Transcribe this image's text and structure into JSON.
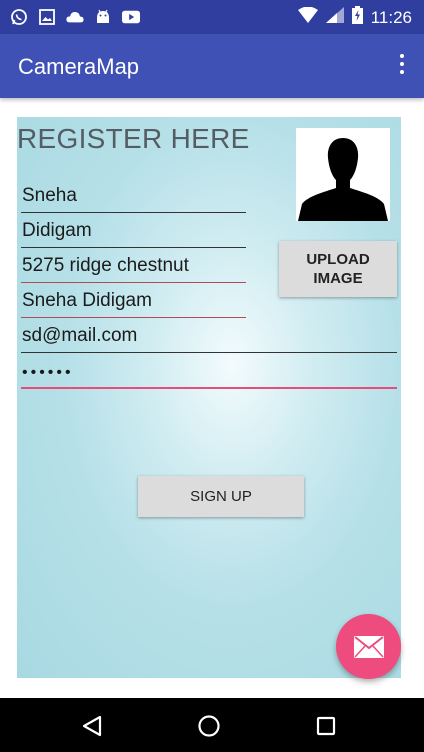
{
  "status_bar": {
    "time": "11:26",
    "left_icons": [
      "whatsapp-icon",
      "image-icon",
      "cloud-icon",
      "android-icon",
      "youtube-icon"
    ],
    "right_icons": [
      "wifi-icon",
      "signal-icon",
      "battery-icon"
    ]
  },
  "app_bar": {
    "title": "CameraMap",
    "menu_icon": "more-vert-icon"
  },
  "form": {
    "title": "REGISTER HERE",
    "fields": {
      "first_name": "Sneha",
      "last_name": "Didigam",
      "address": "5275 ridge chestnut",
      "username": "Sneha Didigam",
      "email": "sd@mail.com",
      "password": "••••••"
    },
    "upload_button_line1": "UPLOAD",
    "upload_button_line2": "IMAGE",
    "signup_button": "SIGN UP"
  },
  "fab": {
    "icon": "mail-icon"
  },
  "colors": {
    "status_bar": "#303F9F",
    "app_bar": "#3F51B5",
    "accent": "#EE4B7E",
    "panel": "#B6E0E8"
  },
  "nav_bar": {
    "icons": [
      "back-icon",
      "home-icon",
      "recents-icon"
    ]
  }
}
